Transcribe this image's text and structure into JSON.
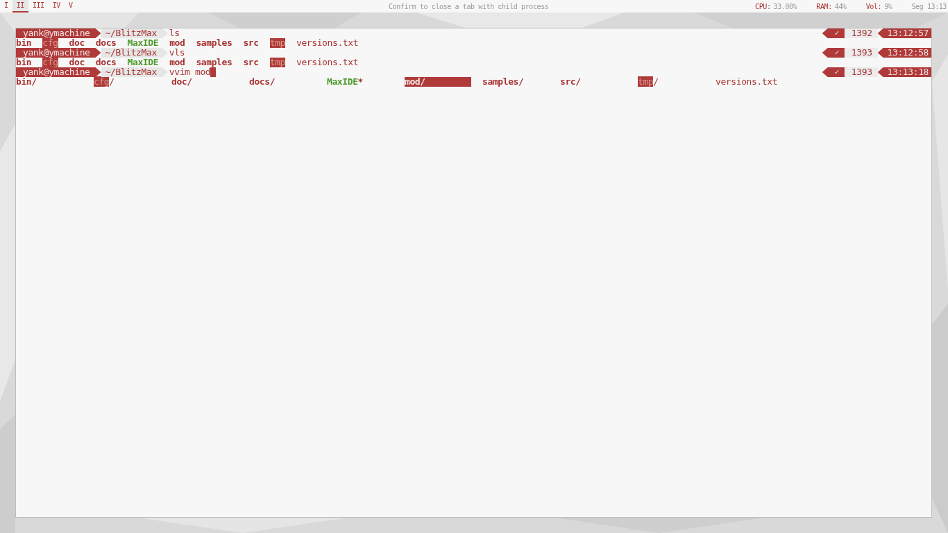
{
  "workspaces": [
    {
      "label": "I",
      "selected": false
    },
    {
      "label": "II",
      "selected": true
    },
    {
      "label": "III",
      "selected": false
    },
    {
      "label": "IV",
      "selected": false
    },
    {
      "label": "V",
      "selected": false
    }
  ],
  "title": "Confirm to close a tab with child process",
  "stats": [
    {
      "label": "CPU:",
      "value": "33.00%"
    },
    {
      "label": "RAM:",
      "value": "44%"
    },
    {
      "label": "Vol:",
      "value": "9%"
    }
  ],
  "clock": "Seg 13:13",
  "terminal": {
    "blocks": [
      {
        "user": "yank@ymachine",
        "path": "~/BlitzMax",
        "command": "ls",
        "cursor": false,
        "status": "✓",
        "count": "1392",
        "time": "13:12:57",
        "output": {
          "kind": "list",
          "entries": [
            {
              "name": "bin",
              "kind": "dir",
              "selected": false
            },
            {
              "name": "cfg",
              "kind": "writable",
              "selected": false
            },
            {
              "name": "doc",
              "kind": "dir",
              "selected": false
            },
            {
              "name": "docs",
              "kind": "dir",
              "selected": false
            },
            {
              "name": "MaxIDE",
              "kind": "exec",
              "selected": false
            },
            {
              "name": "mod",
              "kind": "dir",
              "selected": false
            },
            {
              "name": "samples",
              "kind": "dir",
              "selected": false
            },
            {
              "name": "src",
              "kind": "dir",
              "selected": false
            },
            {
              "name": "tmp",
              "kind": "writable",
              "selected": false
            },
            {
              "name": "versions.txt",
              "kind": "file",
              "selected": false
            }
          ]
        }
      },
      {
        "user": "yank@ymachine",
        "path": "~/BlitzMax",
        "command": "vls",
        "cursor": false,
        "status": "✓",
        "count": "1393",
        "time": "13:12:58",
        "output": {
          "kind": "list",
          "entries": [
            {
              "name": "bin",
              "kind": "dir",
              "selected": false
            },
            {
              "name": "cfg",
              "kind": "writable",
              "selected": false
            },
            {
              "name": "doc",
              "kind": "dir",
              "selected": false
            },
            {
              "name": "docs",
              "kind": "dir",
              "selected": false
            },
            {
              "name": "MaxIDE",
              "kind": "exec",
              "selected": false
            },
            {
              "name": "mod",
              "kind": "dir",
              "selected": false
            },
            {
              "name": "samples",
              "kind": "dir",
              "selected": false
            },
            {
              "name": "src",
              "kind": "dir",
              "selected": false
            },
            {
              "name": "tmp",
              "kind": "writable",
              "selected": false
            },
            {
              "name": "versions.txt",
              "kind": "file",
              "selected": false
            }
          ]
        }
      },
      {
        "user": "yank@ymachine",
        "path": "~/BlitzMax",
        "command": "vvim mod",
        "cursor": true,
        "status": "✓",
        "count": "1393",
        "time": "13:13:18",
        "output": {
          "kind": "grid",
          "entries": [
            {
              "name": "bin/",
              "kind": "dir",
              "selected": false
            },
            {
              "name": "cfg",
              "suffix": "/",
              "kind": "writable",
              "selected": false
            },
            {
              "name": "doc/",
              "kind": "dir",
              "selected": false
            },
            {
              "name": "docs/",
              "kind": "dir",
              "selected": false
            },
            {
              "name": "MaxIDE",
              "suffix": "*",
              "kind": "exec",
              "selected": false
            },
            {
              "name": "mod/",
              "kind": "dir",
              "selected": true
            },
            {
              "name": "samples/",
              "kind": "dir",
              "selected": false
            },
            {
              "name": "src/",
              "kind": "dir",
              "selected": false
            },
            {
              "name": "tmp",
              "suffix": "/",
              "kind": "writable",
              "selected": false
            },
            {
              "name": "versions.txt",
              "kind": "file",
              "selected": false
            }
          ]
        }
      }
    ]
  }
}
